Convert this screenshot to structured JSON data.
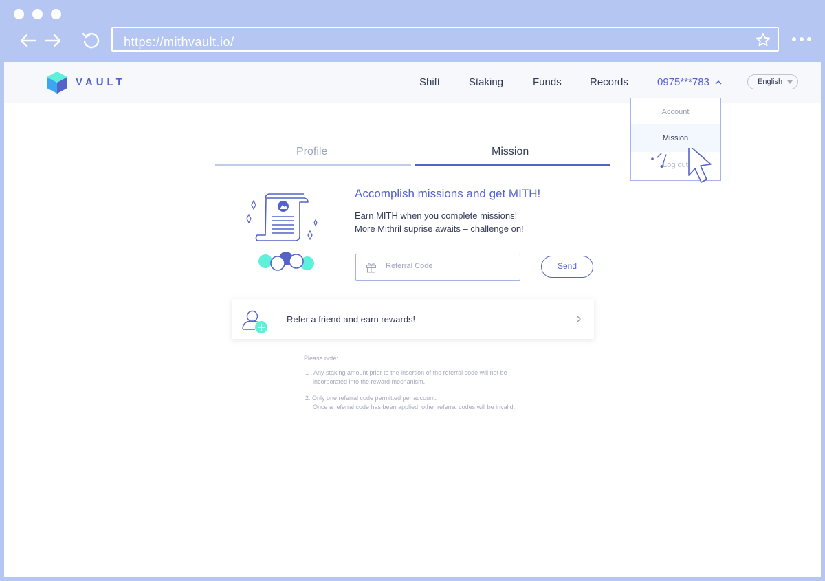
{
  "browser": {
    "url": "https://mithvault.io/"
  },
  "header": {
    "logo_text": "VAULT",
    "nav": [
      "Shift",
      "Staking",
      "Funds",
      "Records"
    ],
    "account": "0975***783",
    "language": "English"
  },
  "dropdown": {
    "items": [
      "Account",
      "Mission",
      "Log out"
    ]
  },
  "tabs": [
    "Profile",
    "Mission"
  ],
  "mission": {
    "headline": "Accomplish missions and get MITH!",
    "desc1": "Earn MITH when you complete missions!",
    "desc2": "More Mithril suprise awaits – challenge on!",
    "referral_placeholder": "Referral Code",
    "send_label": "Send",
    "refer_text": "Refer a friend and earn rewards!"
  },
  "notes": {
    "title": "Please note:",
    "item1_line1": "1 . Any staking amount prior to the insertion of the referral code will not be",
    "item1_line2": "incorporated into the reward mechanism.",
    "item2_line1": "2. Only one referral code permitted per account.",
    "item2_line2": "Once a referral code has been applied, other referral codes will be invalid."
  },
  "colors": {
    "frame": "#b5c6f2",
    "accent": "#5563c9",
    "teal": "#5ef0d8",
    "text": "#333a55"
  }
}
